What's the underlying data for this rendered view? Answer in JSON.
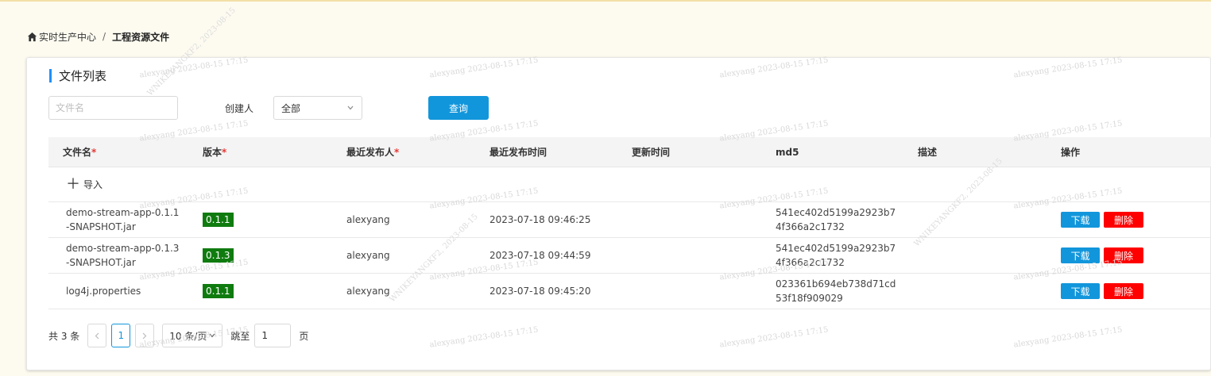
{
  "breadcrumb": {
    "root": "实时生产中心",
    "separator": "/",
    "current": "工程资源文件"
  },
  "card": {
    "title": "文件列表"
  },
  "filters": {
    "filename_placeholder": "文件名",
    "creator_label": "创建人",
    "creator_value": "全部",
    "query_label": "查询"
  },
  "table": {
    "headers": {
      "name": "文件名",
      "version": "版本",
      "publisher": "最近发布人",
      "publish_time": "最近发布时间",
      "update_time": "更新时间",
      "md5": "md5",
      "description": "描述",
      "actions": "操作"
    },
    "required_mark": "*",
    "import_label": "导入",
    "download_label": "下载",
    "delete_label": "删除",
    "rows": [
      {
        "name_line1": "demo-stream-app-0.1.1",
        "name_line2": "-SNAPSHOT.jar",
        "version": "0.1.1",
        "publisher": "alexyang",
        "publish_time": "2023-07-18 09:46:25",
        "update_time": "",
        "md5_line1": "541ec402d5199a2923b7",
        "md5_line2": "4f366a2c1732",
        "description": ""
      },
      {
        "name_line1": "demo-stream-app-0.1.3",
        "name_line2": "-SNAPSHOT.jar",
        "version": "0.1.3",
        "publisher": "alexyang",
        "publish_time": "2023-07-18 09:44:59",
        "update_time": "",
        "md5_line1": "541ec402d5199a2923b7",
        "md5_line2": "4f366a2c1732",
        "description": ""
      },
      {
        "name_line1": "log4j.properties",
        "name_line2": "",
        "version": "0.1.1",
        "publisher": "alexyang",
        "publish_time": "2023-07-18 09:45:20",
        "update_time": "",
        "md5_line1": "023361b694eb738d71cd",
        "md5_line2": "53f18f909029",
        "description": ""
      }
    ]
  },
  "pagination": {
    "total": "共 3 条",
    "current_page": "1",
    "page_size": "10 条/页",
    "jump_label": "跳至",
    "jump_value": "1",
    "page_suffix": "页"
  },
  "watermark": {
    "text": "alexyang 2023-08-15 17:15",
    "diag": "WNIKEYANGKF2, 2023-08-15"
  },
  "colors": {
    "accent": "#1296db",
    "version_badge": "#0f7b0f",
    "delete": "#ff0000",
    "required": "#e53935"
  }
}
